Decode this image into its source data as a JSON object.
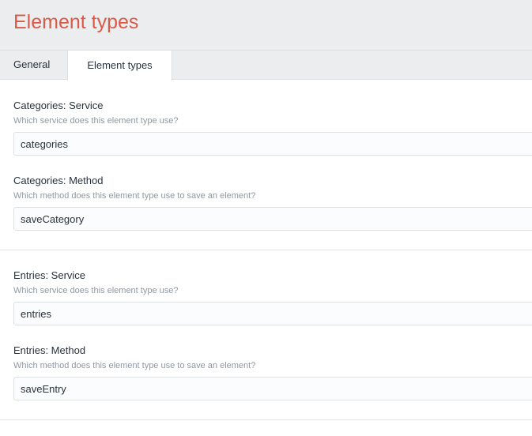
{
  "header": {
    "title": "Element types"
  },
  "tabs": [
    {
      "label": "General",
      "active": false
    },
    {
      "label": "Element types",
      "active": true
    }
  ],
  "groups": [
    {
      "fields": [
        {
          "label": "Categories: Service",
          "instructions": "Which service does this element type use?",
          "value": "categories"
        },
        {
          "label": "Categories: Method",
          "instructions": "Which method does this element type use to save an element?",
          "value": "saveCategory"
        }
      ]
    },
    {
      "fields": [
        {
          "label": "Entries: Service",
          "instructions": "Which service does this element type use?",
          "value": "entries"
        },
        {
          "label": "Entries: Method",
          "instructions": "Which method does this element type use to save an element?",
          "value": "saveEntry"
        }
      ]
    }
  ],
  "colors": {
    "title": "#da5a47",
    "header_bg": "#ebedef",
    "text": "#29323d",
    "instructions": "#8f98a3",
    "border": "#dde0e3"
  }
}
